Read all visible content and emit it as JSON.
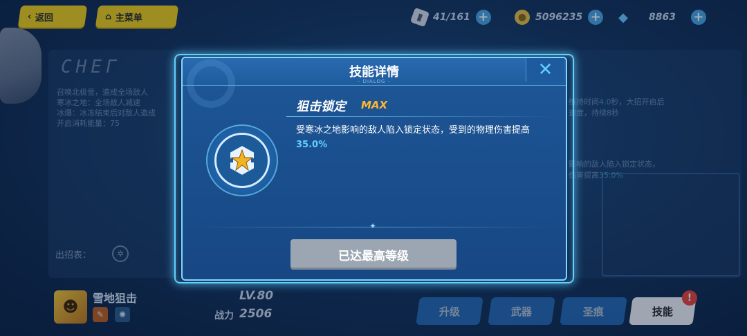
{
  "topbar": {
    "back_label": "返回",
    "home_label": "主菜单",
    "stamina": "41/161",
    "coins": "5096235",
    "crystals": "8863"
  },
  "background": {
    "panel_title": "CHEГ",
    "left_text": "召唤北极雪，造成全场敌人\n寒冰之地：全场敌人减速\n冰爆：冰冻结束后对敌人造成\n开启消耗能量：75",
    "right_line1_a": "维持时间",
    "right_line1_num": "4.0",
    "right_line1_b": "秒，大招开启后",
    "right_line2": "速度，持续8秒",
    "right_line3": "影响的敌人陷入锁定状态，",
    "right_line4_a": "伤害提高",
    "right_line4_num": "35.0%"
  },
  "character": {
    "name": "雪地狙击",
    "level": "LV.80",
    "power_label": "战力",
    "power": "2506",
    "moves_label": "出招表："
  },
  "tabs": {
    "upgrade": "升级",
    "weapon": "武器",
    "stigmata": "圣痕",
    "skill": "技能",
    "skill_badge": "!"
  },
  "dialog": {
    "title": "技能详情",
    "subtitle": "- DIALOG -",
    "close": "✕",
    "skill_name": "狙击锁定",
    "skill_level": "MAX",
    "desc_main": "受寒冰之地影响的敌人陷入锁定状态，受到的物理伤害提高",
    "desc_value": "35.0%",
    "button_label": "已达最高等级"
  },
  "colors": {
    "accent": "#5fd0ff",
    "max_orange": "#ffb62e",
    "disabled_button": "#9ba6b2",
    "topbar_yellow": "#f0cf1b"
  }
}
